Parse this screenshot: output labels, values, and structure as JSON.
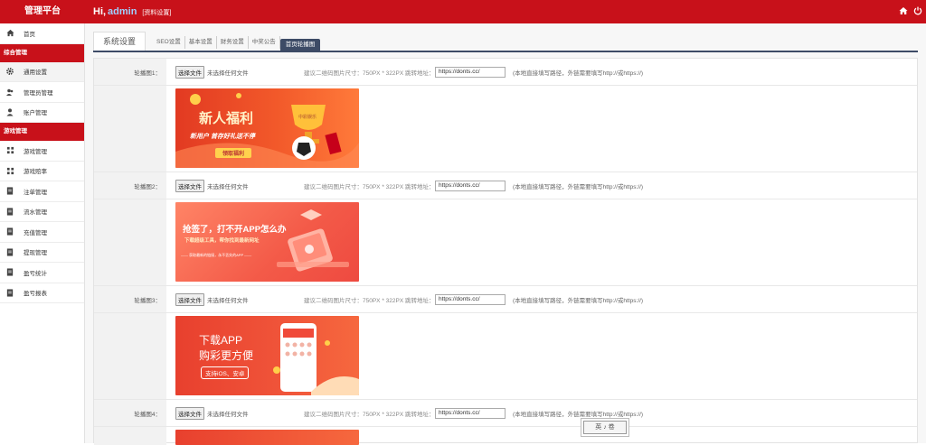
{
  "header": {
    "brand": "管理平台",
    "greeting": "Hi,",
    "username": "admin",
    "profile_link": "[资料设置]",
    "home_icon": "home-icon",
    "power_icon": "power-icon"
  },
  "sidebar": {
    "items_top": [
      {
        "label": "首页",
        "icon": "home-icon"
      }
    ],
    "section1": "综合管理",
    "items_general": [
      {
        "label": "通用设置",
        "icon": "gear-icon"
      },
      {
        "label": "管理员管理",
        "icon": "users-icon"
      },
      {
        "label": "账户管理",
        "icon": "user-icon"
      }
    ],
    "section2": "游戏管理",
    "items_games": [
      {
        "label": "游戏管理",
        "icon": "grid-icon"
      },
      {
        "label": "游戏赔率",
        "icon": "grid-icon"
      },
      {
        "label": "注单管理",
        "icon": "doc-icon"
      },
      {
        "label": "流水管理",
        "icon": "doc-icon"
      },
      {
        "label": "充值管理",
        "icon": "doc-icon"
      },
      {
        "label": "提现管理",
        "icon": "doc-icon"
      },
      {
        "label": "盈亏统计",
        "icon": "doc-icon"
      },
      {
        "label": "盈亏报表",
        "icon": "doc-icon"
      }
    ]
  },
  "tabs": {
    "main": "系统设置",
    "items": [
      "SEO设置",
      "基本设置",
      "财务设置",
      "中奖公告",
      "首页轮播图"
    ],
    "active_index": 4
  },
  "carousel": {
    "file_button": "选择文件",
    "no_file": "未选择任何文件",
    "hint": "建议二维码图片尺寸：750PX * 322PX 跳转地址：",
    "note": "(本地直接填写路径，外链需要填写http://或https://)",
    "rows": [
      {
        "label": "轮播图1：",
        "url": "https://donts.cc/"
      },
      {
        "label": "轮播图2：",
        "url": "https://donts.cc/"
      },
      {
        "label": "轮播图3：",
        "url": "https://donts.cc/"
      },
      {
        "label": "轮播图4：",
        "url": "https://donts.cc/"
      }
    ]
  },
  "banners": {
    "b1": {
      "title": "新人福利",
      "sub": "新用户 首存好礼送不停",
      "btn": "领取福利",
      "cup": "中彩娱乐"
    },
    "b2": {
      "title": "抢签了，打不开APP怎么办",
      "sub": "下载超级工具，帮你找到最新网址",
      "foot": "—— 获取最新的链接，永不丢失的APP ——"
    },
    "b3": {
      "title": "下载APP",
      "sub": "购彩更方便",
      "tag": "支持iOS、安卓"
    }
  },
  "watermark": "英 ♪ 卷",
  "colors": {
    "brand_red": "#c8111a",
    "tab_active": "#3d4b66",
    "username_blue": "#9fd0ff"
  }
}
